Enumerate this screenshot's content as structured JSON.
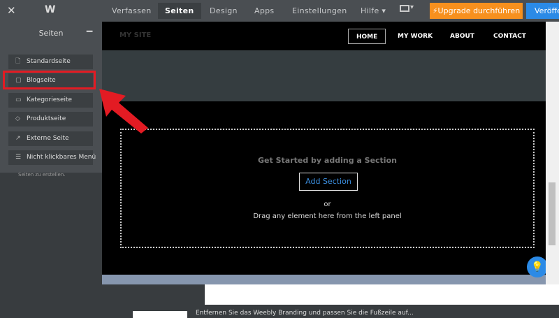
{
  "topbar": {
    "close": "✕",
    "logo": "W",
    "nav": [
      "Verfassen",
      "Seiten",
      "Design",
      "Apps",
      "Einstellungen",
      "Hilfe ▾"
    ],
    "device_dropdown": "▾",
    "upgrade": "Upgrade durchführen",
    "upgrade_icon": "⚡",
    "publish": "Veröffentlichen"
  },
  "panel": {
    "title": "Seiten",
    "minimize": "−",
    "items": [
      {
        "icon": "🗋",
        "label": "Standardseite"
      },
      {
        "icon": "▢",
        "label": "Blogseite"
      },
      {
        "icon": "▭",
        "label": "Kategorieseite"
      },
      {
        "icon": "◇",
        "label": "Produktseite"
      },
      {
        "icon": "↗",
        "label": "Externe Seite"
      },
      {
        "icon": "☰",
        "label": "Nicht klickbares Menü"
      }
    ],
    "hint": "Seiten zu erstellen."
  },
  "site": {
    "name": "MY SITE",
    "nav": [
      "HOME",
      "MY WORK",
      "ABOUT",
      "CONTACT"
    ],
    "get_started": "Get Started by adding a Section",
    "add_section": "Add Section",
    "or": "or",
    "drag": "Drag any element here from the left panel"
  },
  "footer": {
    "text": "Entfernen Sie das Weebly Branding und passen Sie die Fußzeile auf..."
  },
  "colors": {
    "upgrade": "#f7901e",
    "publish": "#2b8ae6",
    "highlight": "#e31b23"
  }
}
